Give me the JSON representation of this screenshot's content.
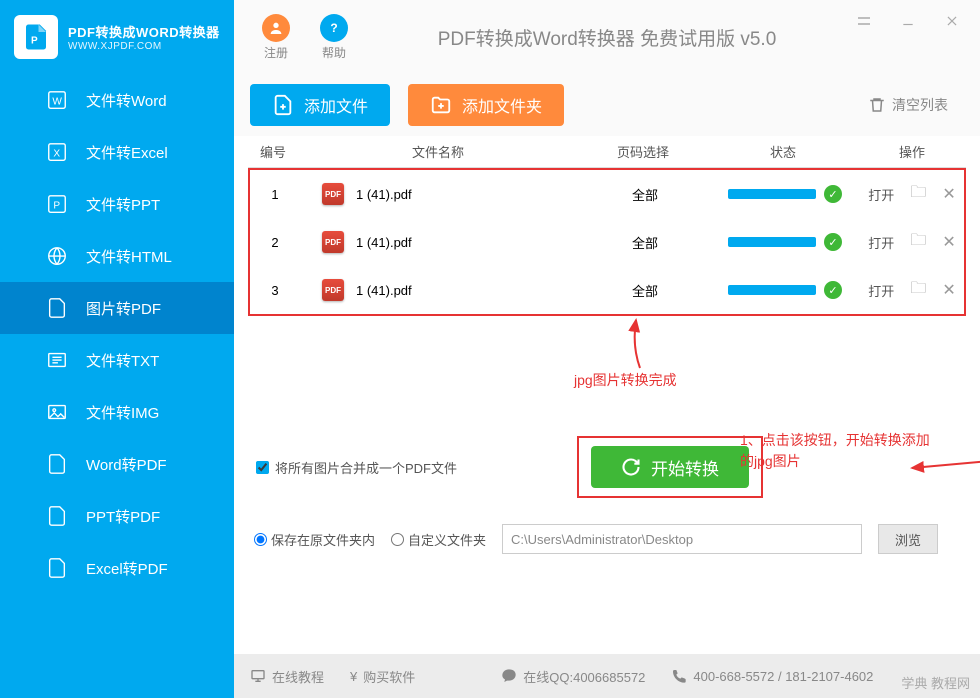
{
  "logo": {
    "title": "PDF转换成WORD转换器",
    "sub": "WWW.XJPDF.COM"
  },
  "nav": [
    {
      "label": "文件转Word"
    },
    {
      "label": "文件转Excel"
    },
    {
      "label": "文件转PPT"
    },
    {
      "label": "文件转HTML"
    },
    {
      "label": "图片转PDF"
    },
    {
      "label": "文件转TXT"
    },
    {
      "label": "文件转IMG"
    },
    {
      "label": "Word转PDF"
    },
    {
      "label": "PPT转PDF"
    },
    {
      "label": "Excel转PDF"
    }
  ],
  "titlebar": {
    "register": "注册",
    "help": "帮助",
    "title": "PDF转换成Word转换器 免费试用版 v5.0"
  },
  "toolbar": {
    "add_file": "添加文件",
    "add_folder": "添加文件夹",
    "clear_list": "清空列表"
  },
  "table": {
    "headers": {
      "num": "编号",
      "name": "文件名称",
      "page": "页码选择",
      "status": "状态",
      "op": "操作"
    },
    "rows": [
      {
        "num": "1",
        "name": "1 (41).pdf",
        "page": "全部",
        "open": "打开"
      },
      {
        "num": "2",
        "name": "1 (41).pdf",
        "page": "全部",
        "open": "打开"
      },
      {
        "num": "3",
        "name": "1 (41).pdf",
        "page": "全部",
        "open": "打开"
      }
    ]
  },
  "annotations": {
    "done": "jpg图片转换完成",
    "tip": "1、点击该按钮，开始转换添加的jpg图片"
  },
  "lower": {
    "merge_checkbox": "将所有图片合并成一个PDF文件",
    "start_convert": "开始转换",
    "save_original": "保存在原文件夹内",
    "save_custom": "自定义文件夹",
    "path": "C:\\Users\\Administrator\\Desktop",
    "browse": "浏览"
  },
  "footer": {
    "tutorial": "在线教程",
    "buy": "购买软件",
    "qq": "在线QQ:4006685572",
    "phone": "400-668-5572 / 181-2107-4602"
  },
  "watermark": "学典 教程网"
}
